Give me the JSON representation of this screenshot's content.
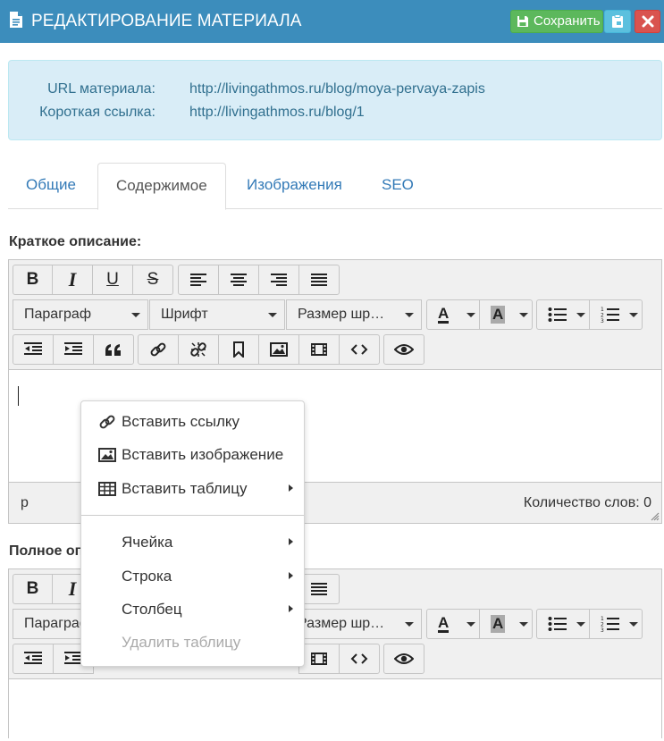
{
  "header": {
    "title": "РЕДАКТИРОВАНИЕ МАТЕРИАЛА",
    "save_label": "Сохранить",
    "colors": {
      "bar": "#3c8dbc",
      "save": "#5cb85c",
      "copy": "#5bc0de",
      "close": "#d9534f"
    }
  },
  "info": {
    "url_label": "URL материала:",
    "url_value": "http://livingathmos.ru/blog/moya-pervaya-zapis",
    "short_label": "Короткая ссылка:",
    "short_value": "http://livingathmos.ru/blog/1"
  },
  "tabs": [
    {
      "label": "Общие",
      "active": false
    },
    {
      "label": "Содержимое",
      "active": true
    },
    {
      "label": "Изображения",
      "active": false
    },
    {
      "label": "SEO",
      "active": false
    }
  ],
  "short_desc": {
    "label": "Краткое описание:",
    "status_path": "p",
    "word_count": "Количество слов: 0"
  },
  "full_desc": {
    "label": "Полное описание:"
  },
  "toolbar": {
    "bold": "B",
    "italic": "I",
    "underline": "U",
    "strike": "S",
    "paragraph": "Параграф",
    "font": "Шрифт",
    "font_size": "Размер шр…",
    "text_color": "A",
    "bg_color": "A",
    "paragraph_partial": "Параграф"
  },
  "context_menu": {
    "items": [
      {
        "label": "Вставить ссылку",
        "icon": "link-icon",
        "submenu": false,
        "disabled": false
      },
      {
        "label": "Вставить изображение",
        "icon": "image-icon",
        "submenu": false,
        "disabled": false
      },
      {
        "label": "Вставить таблицу",
        "icon": "table-icon",
        "submenu": true,
        "disabled": false
      },
      {
        "label": "Ячейка",
        "submenu": true,
        "disabled": false
      },
      {
        "label": "Строка",
        "submenu": true,
        "disabled": false
      },
      {
        "label": "Столбец",
        "submenu": true,
        "disabled": false
      },
      {
        "label": "Удалить таблицу",
        "submenu": false,
        "disabled": true
      }
    ]
  }
}
